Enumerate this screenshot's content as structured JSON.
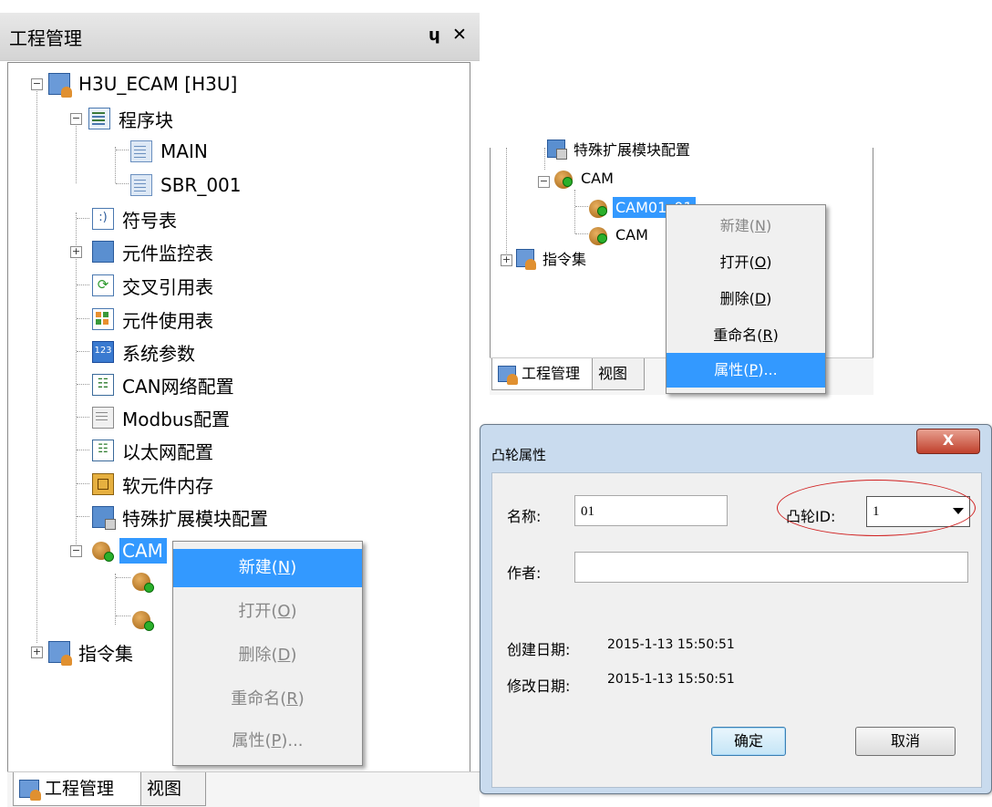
{
  "left_panel": {
    "title": "工程管理",
    "pin_glyph": "ᵖ",
    "pin_symbol": "ɥ",
    "close_symbol": "✕",
    "tree": {
      "root": "H3U_ECAM [H3U]",
      "program_block": "程序块",
      "main": "MAIN",
      "sbr": "SBR_001",
      "symbol_table": "符号表",
      "monitor_table": "元件监控表",
      "cross_ref": "交叉引用表",
      "usage_table": "元件使用表",
      "sys_params": "系统参数",
      "can_config": "CAN网络配置",
      "modbus_config": "Modbus配置",
      "ethernet_config": "以太网配置",
      "soft_memory": "软元件内存",
      "special_module": "特殊扩展模块配置",
      "cam": "CAM",
      "cam_selected_visible": "CAM",
      "instruction_set": "指令集"
    },
    "context_menu": [
      "新建(N)",
      "打开(O)",
      "删除(D)",
      "重命名(R)",
      "属性(P)..."
    ],
    "context_menu_keys": [
      "N",
      "O",
      "D",
      "R",
      "P"
    ],
    "tabs": [
      "工程管理",
      "视图"
    ]
  },
  "top_right_panel": {
    "tree": {
      "special_module_partial": "特殊扩展模块配置",
      "cam": "CAM",
      "cam_item_1": "CAM01_01",
      "cam_item_2": "CAM",
      "instruction_set": "指令集"
    },
    "context_menu": [
      "新建(N)",
      "打开(O)",
      "删除(D)",
      "重命名(R)",
      "属性(P)..."
    ],
    "tabs": [
      "工程管理",
      "视图"
    ]
  },
  "dialog": {
    "title": "凸轮属性",
    "close_label": "X",
    "name_label": "名称:",
    "name_value": "01",
    "cam_id_label": "凸轮ID:",
    "cam_id_value": "1",
    "author_label": "作者:",
    "author_value": "",
    "created_label": "创建日期:",
    "created_value": "2015-1-13 15:50:51",
    "modified_label": "修改日期:",
    "modified_value": "2015-1-13 15:50:51",
    "ok_label": "确定",
    "cancel_label": "取消",
    "highlight_color": "#d02020"
  }
}
